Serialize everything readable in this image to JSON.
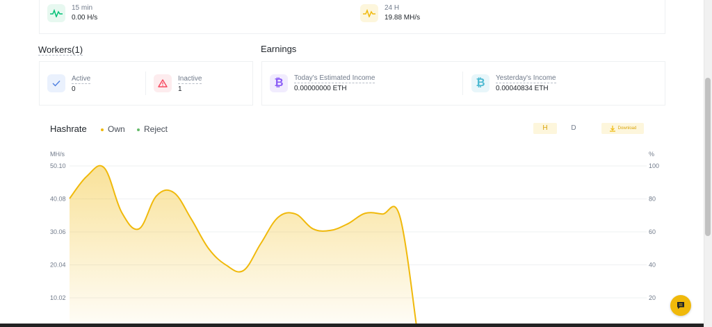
{
  "hashrate_cards": {
    "min15": {
      "label": "15 min",
      "value": "0.00 H/s"
    },
    "h24": {
      "label": "24 H",
      "value": "19.88 MH/s"
    }
  },
  "workers": {
    "title": "Workers(1)",
    "active": {
      "label": "Active",
      "value": "0"
    },
    "inactive": {
      "label": "Inactive",
      "value": "1"
    }
  },
  "earnings": {
    "title": "Earnings",
    "today": {
      "label": "Today's Estimated Income",
      "value": "0.00000000 ETH"
    },
    "yesterday": {
      "label": "Yesterday's Income",
      "value": "0.00040834 ETH"
    }
  },
  "chart_header": {
    "title": "Hashrate",
    "legend_own": "Own",
    "legend_reject": "Reject",
    "btn_h": "H",
    "btn_d": "D",
    "btn_download": "Download"
  },
  "colors": {
    "accent": "#f0b90b",
    "success": "#02c076",
    "danger": "#f6465d",
    "bitcoin_purple": "#8a5cf6",
    "bitcoin_teal": "#4cb9d1"
  },
  "chart_data": {
    "type": "area",
    "left_axis_unit": "MH/s",
    "right_axis_unit": "%",
    "left_ticks": [
      "50.10",
      "40.08",
      "30.06",
      "20.04",
      "10.02"
    ],
    "right_ticks": [
      "100",
      "80",
      "60",
      "40",
      "20"
    ],
    "ylim": [
      0,
      50.1
    ],
    "series": [
      {
        "name": "Own",
        "x": [
          0,
          1,
          2,
          3,
          4,
          5,
          6,
          7,
          8,
          9,
          10,
          11,
          12,
          13,
          14,
          15,
          16,
          17,
          18,
          19,
          20
        ],
        "values": [
          40.2,
          47.0,
          49.5,
          36.0,
          31.0,
          41.0,
          42.0,
          34.0,
          25.0,
          20.0,
          18.3,
          26.5,
          34.5,
          35.5,
          31.0,
          30.5,
          32.5,
          35.7,
          35.5,
          34.8,
          0
        ]
      }
    ]
  }
}
